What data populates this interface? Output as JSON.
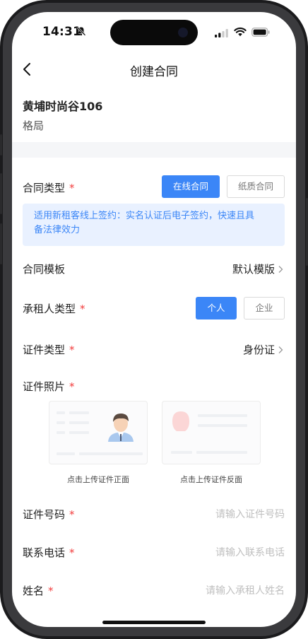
{
  "status_bar": {
    "time": "14:31"
  },
  "nav": {
    "title": "创建合同"
  },
  "property": {
    "name": "黄埔时尚谷106",
    "layout": "格局"
  },
  "contract_type": {
    "label": "合同类型",
    "required": "*",
    "options": [
      "在线合同",
      "纸质合同"
    ],
    "selected": "在线合同",
    "notice": [
      "适用新租客线上签约：实名认证后电子签约，快速且具",
      "备法律效力"
    ]
  },
  "template": {
    "label": "合同模板",
    "value": "默认模版"
  },
  "tenant_type": {
    "label": "承租人类型",
    "required": "*",
    "options": [
      "个人",
      "企业"
    ],
    "selected": "个人"
  },
  "id_type": {
    "label": "证件类型",
    "required": "*",
    "value": "身份证"
  },
  "id_photo": {
    "label": "证件照片",
    "required": "*",
    "front_caption": "点击上传证件正面",
    "back_caption": "点击上传证件反面"
  },
  "id_number": {
    "label": "证件号码",
    "required": "*",
    "placeholder": "请输入证件号码"
  },
  "phone": {
    "label": "联系电话",
    "required": "*",
    "placeholder": "请输入联系电话"
  },
  "name": {
    "label": "姓名",
    "required": "*",
    "placeholder": "请输入承租人姓名"
  },
  "colors": {
    "accent": "#3b86f7",
    "required": "#f23d3d",
    "notice_bg": "#e9f1ff"
  },
  "icons": [
    "bell-muted-icon",
    "cellular-signal-icon",
    "wifi-icon",
    "battery-icon",
    "back-chevron-icon",
    "chevron-right-icon",
    "person-avatar-icon",
    "id-card-front-icon",
    "id-card-back-icon"
  ]
}
